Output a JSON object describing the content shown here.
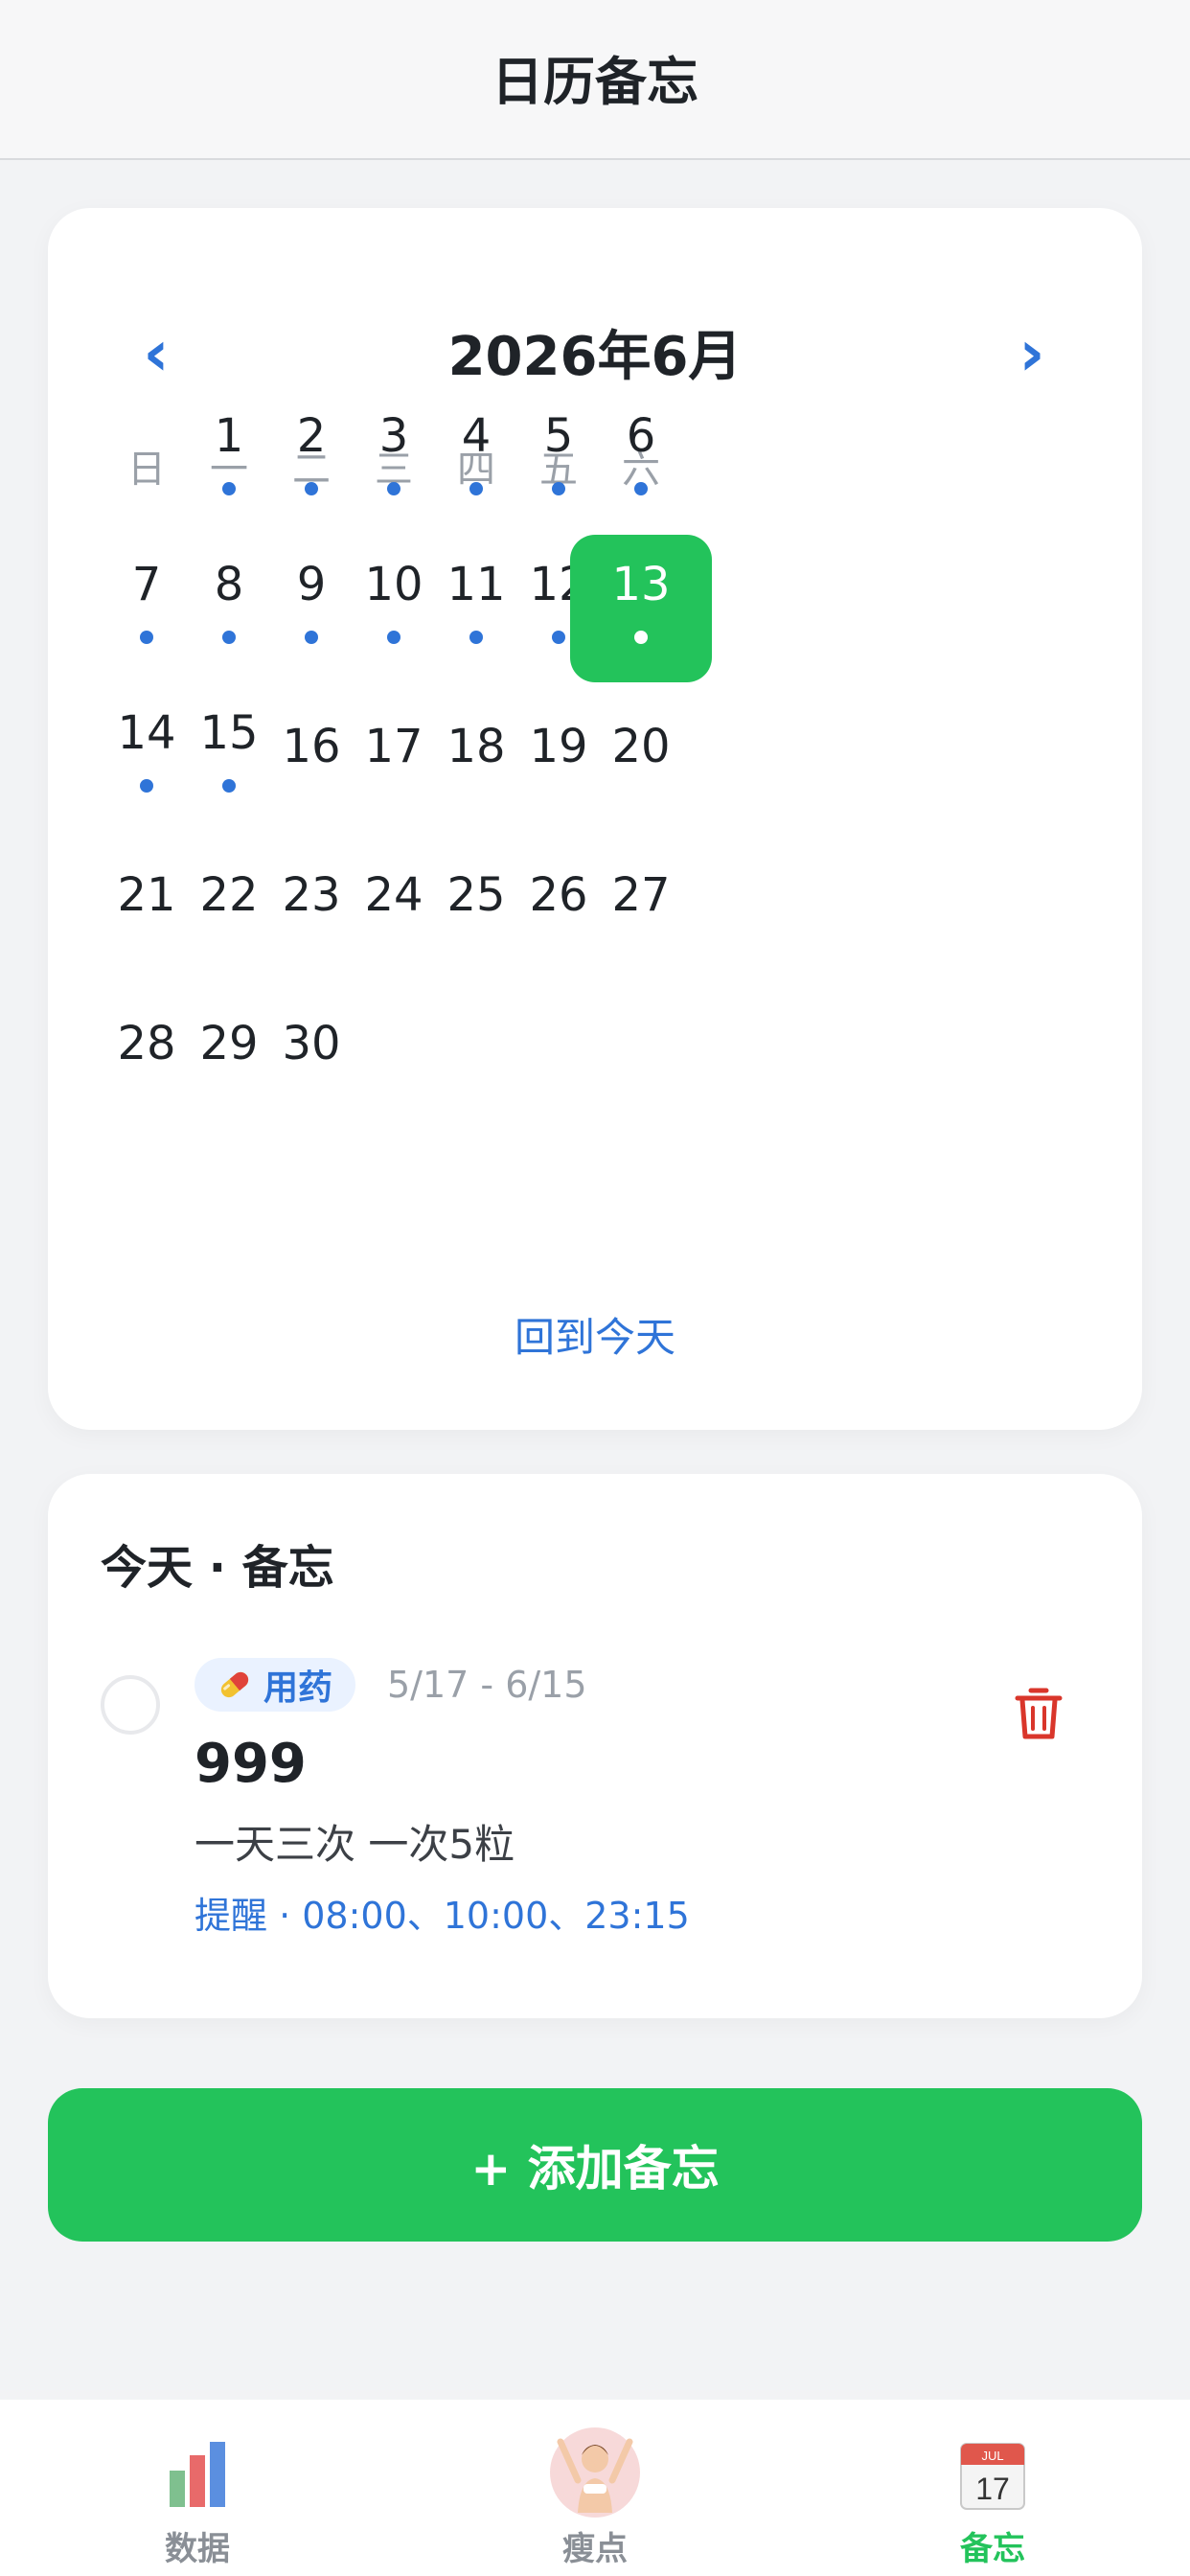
{
  "header": {
    "title": "日历备忘"
  },
  "calendar": {
    "month_title": "2026年6月",
    "prev_icon": "chevron-left-icon",
    "next_icon": "chevron-right-icon",
    "weekdays": [
      "日",
      "一",
      "二",
      "三",
      "四",
      "五",
      "六"
    ],
    "weeks": [
      [
        {
          "day": ""
        },
        {
          "day": "1",
          "dot": true
        },
        {
          "day": "2",
          "dot": true
        },
        {
          "day": "3",
          "dot": true
        },
        {
          "day": "4",
          "dot": true
        },
        {
          "day": "5",
          "dot": true
        },
        {
          "day": "6",
          "dot": true
        }
      ],
      [
        {
          "day": "7",
          "dot": true
        },
        {
          "day": "8",
          "dot": true
        },
        {
          "day": "9",
          "dot": true
        },
        {
          "day": "10",
          "dot": true
        },
        {
          "day": "11",
          "dot": true
        },
        {
          "day": "12",
          "dot": true
        },
        {
          "day": "13",
          "dot": true,
          "selected": true
        }
      ],
      [
        {
          "day": "14",
          "dot": true
        },
        {
          "day": "15",
          "dot": true
        },
        {
          "day": "16"
        },
        {
          "day": "17"
        },
        {
          "day": "18"
        },
        {
          "day": "19"
        },
        {
          "day": "20"
        }
      ],
      [
        {
          "day": "21"
        },
        {
          "day": "22"
        },
        {
          "day": "23"
        },
        {
          "day": "24"
        },
        {
          "day": "25"
        },
        {
          "day": "26"
        },
        {
          "day": "27"
        }
      ],
      [
        {
          "day": "28"
        },
        {
          "day": "29"
        },
        {
          "day": "30"
        },
        {
          "day": ""
        },
        {
          "day": ""
        },
        {
          "day": ""
        },
        {
          "day": ""
        }
      ]
    ],
    "today_link": "回到今天",
    "colors": {
      "accent_blue": "#2f74d8",
      "selected_green": "#23c35b"
    }
  },
  "memo": {
    "heading": "今天 · 备忘",
    "items": [
      {
        "tag_icon": "pill-icon",
        "tag": "用药",
        "date_range": "5/17 - 6/15",
        "title": "999",
        "description": "一天三次 一次5粒",
        "reminder": "提醒 · 08:00、10:00、23:15",
        "delete_icon": "trash-icon"
      }
    ]
  },
  "add_button": {
    "label": "+ 添加备忘"
  },
  "tabbar": {
    "tabs": [
      {
        "label": "数据",
        "icon": "bar-chart-icon",
        "active": false
      },
      {
        "label": "瘦点",
        "icon": "avatar-icon",
        "active": false
      },
      {
        "label": "备忘",
        "icon": "calendar-icon",
        "active": true
      }
    ]
  }
}
